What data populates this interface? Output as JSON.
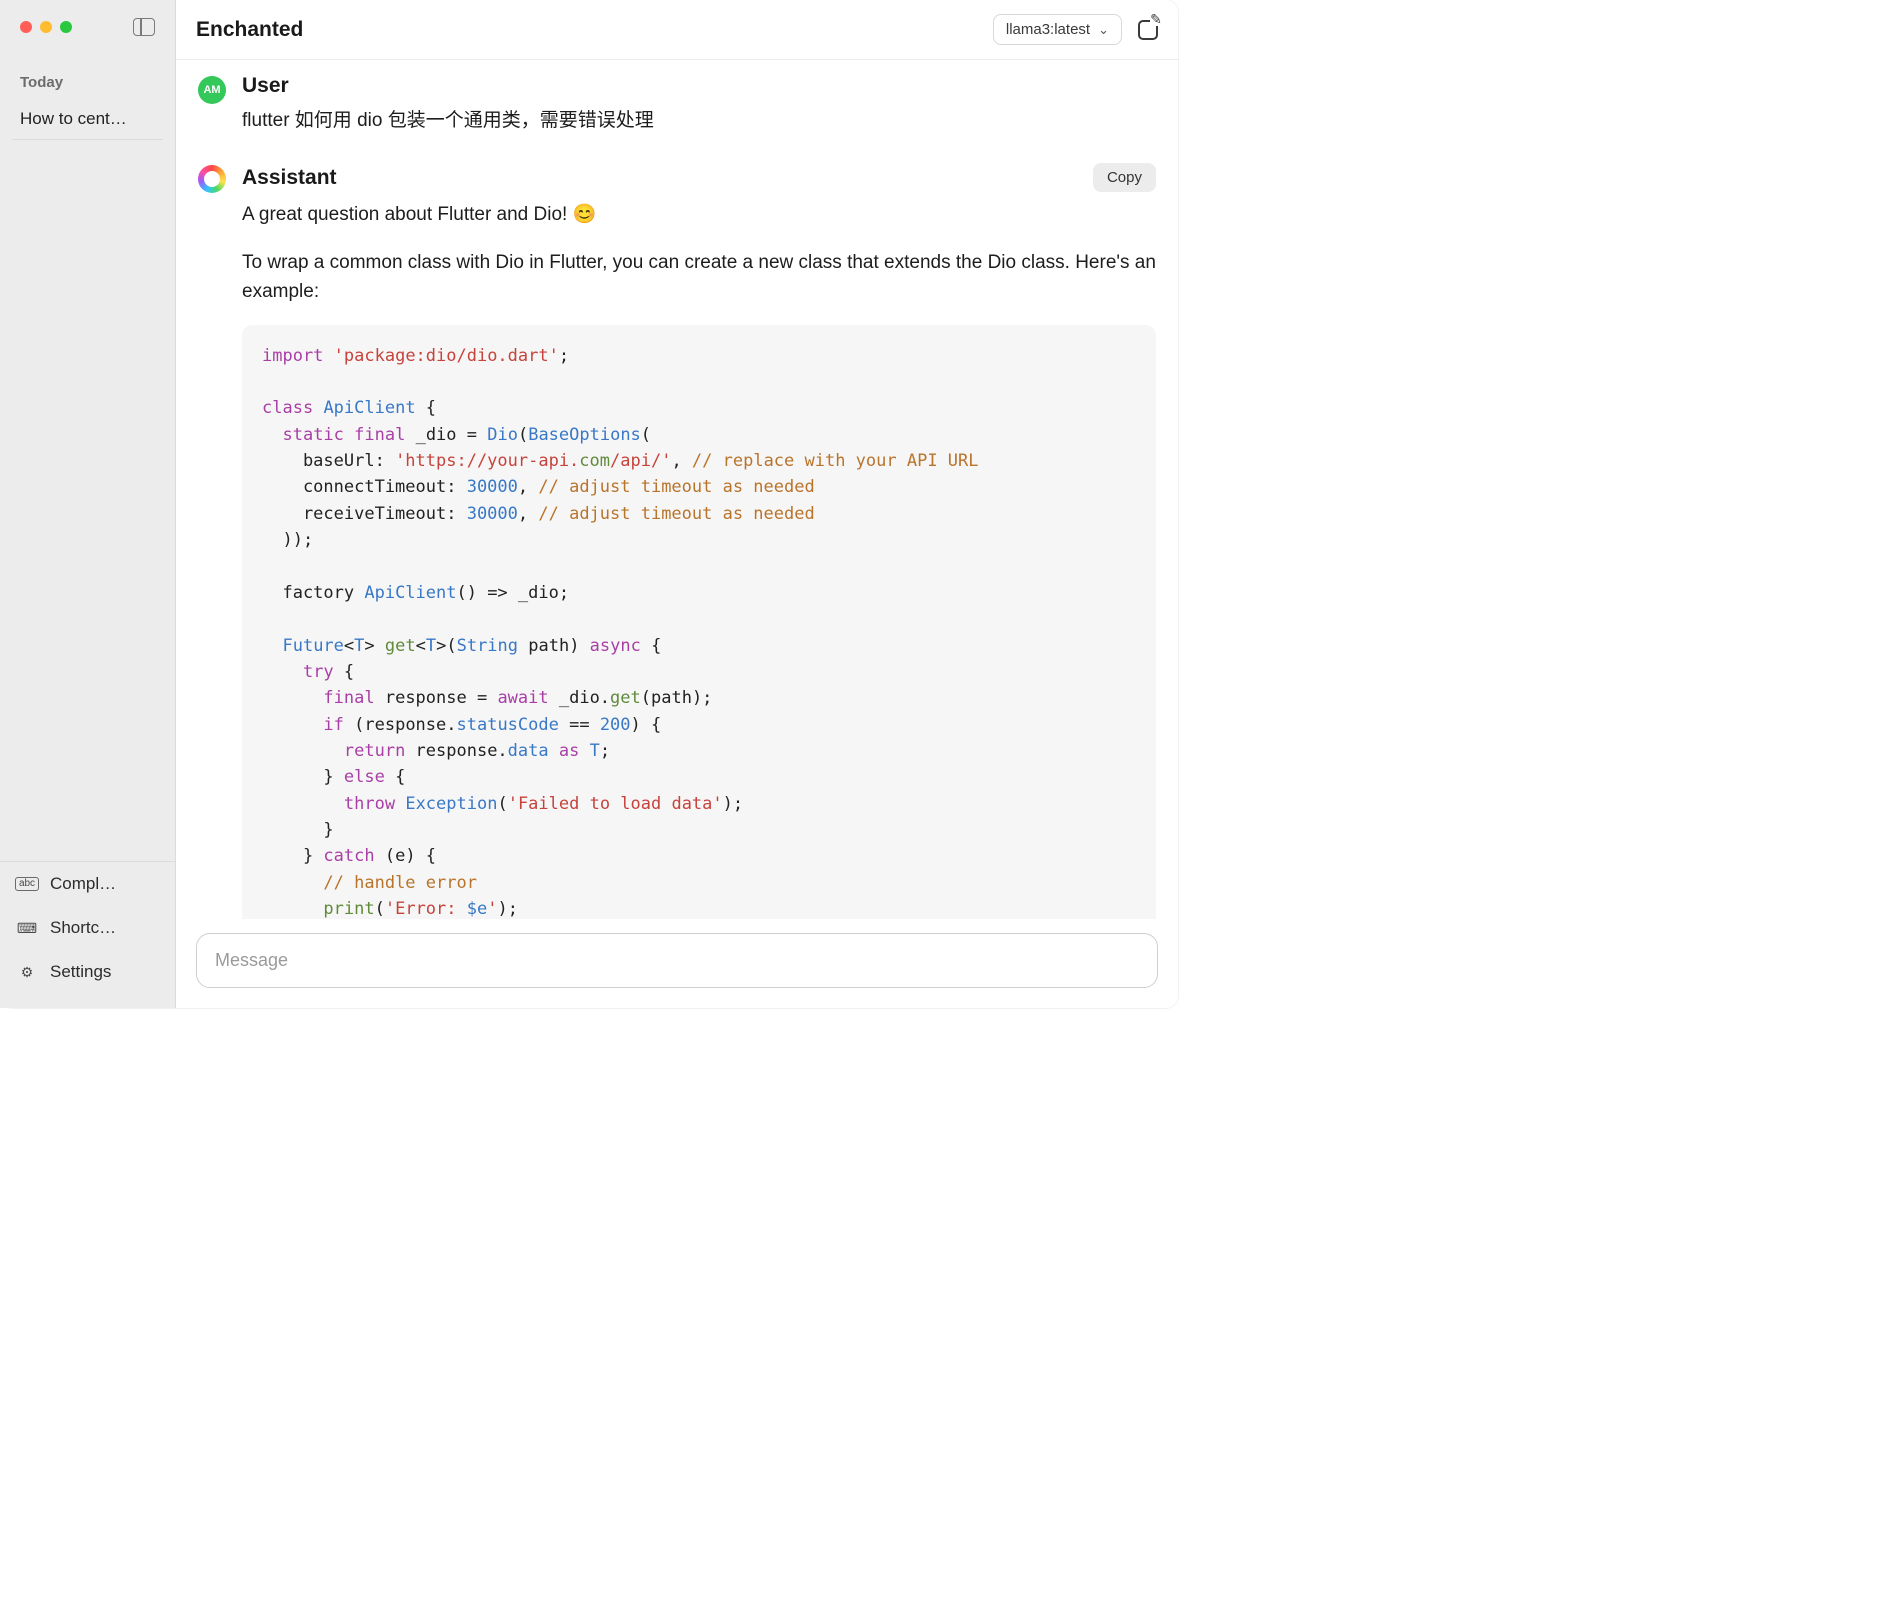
{
  "header": {
    "title": "Enchanted",
    "model": "llama3:latest"
  },
  "sidebar": {
    "section_label": "Today",
    "history": [
      "How to cent…"
    ],
    "footer": {
      "completions": "Compl…",
      "shortcuts": "Shortc…",
      "settings": "Settings"
    }
  },
  "chat": {
    "user": {
      "name": "User",
      "avatar_initials": "AM",
      "message": "flutter 如何用 dio 包装一个通用类，需要错误处理"
    },
    "assistant": {
      "name": "Assistant",
      "copy_label": "Copy",
      "paragraphs": [
        "A great question about Flutter and Dio! 😊",
        "To wrap a common class with Dio in Flutter, you can create a new class that extends the Dio class. Here's an example:"
      ],
      "code_tokens": [
        [
          [
            "kw",
            "import"
          ],
          [
            "pl",
            " "
          ],
          [
            "str",
            "'package:dio/dio.dart'"
          ],
          [
            "pl",
            ";"
          ]
        ],
        [],
        [
          [
            "kw",
            "class"
          ],
          [
            "pl",
            " "
          ],
          [
            "type",
            "ApiClient"
          ],
          [
            "pl",
            " {"
          ]
        ],
        [
          [
            "pl",
            "  "
          ],
          [
            "kw",
            "static"
          ],
          [
            "pl",
            " "
          ],
          [
            "kw",
            "final"
          ],
          [
            "pl",
            " _dio = "
          ],
          [
            "type",
            "Dio"
          ],
          [
            "pl",
            "("
          ],
          [
            "type",
            "BaseOptions"
          ],
          [
            "pl",
            "("
          ]
        ],
        [
          [
            "pl",
            "    baseUrl: "
          ],
          [
            "str",
            "'https://your-api."
          ],
          [
            "call",
            "com"
          ],
          [
            "str",
            "/api/'"
          ],
          [
            "pl",
            ", "
          ],
          [
            "cm",
            "// replace with your API URL"
          ]
        ],
        [
          [
            "pl",
            "    connectTimeout:"
          ],
          [
            "pl",
            " "
          ],
          [
            "num",
            "30000"
          ],
          [
            "pl",
            ", "
          ],
          [
            "cm",
            "// adjust timeout as needed"
          ]
        ],
        [
          [
            "pl",
            "    receiveTimeout:"
          ],
          [
            "pl",
            " "
          ],
          [
            "num",
            "30000"
          ],
          [
            "pl",
            ", "
          ],
          [
            "cm",
            "// adjust timeout as needed"
          ]
        ],
        [
          [
            "pl",
            "  ));"
          ]
        ],
        [],
        [
          [
            "pl",
            "  factory "
          ],
          [
            "type",
            "ApiClient"
          ],
          [
            "pl",
            "() => _dio;"
          ]
        ],
        [],
        [
          [
            "pl",
            "  "
          ],
          [
            "type",
            "Future"
          ],
          [
            "pl",
            "<"
          ],
          [
            "type",
            "T"
          ],
          [
            "pl",
            "> "
          ],
          [
            "call",
            "get"
          ],
          [
            "pl",
            "<"
          ],
          [
            "type",
            "T"
          ],
          [
            "pl",
            ">("
          ],
          [
            "type",
            "String"
          ],
          [
            "pl",
            " path) "
          ],
          [
            "kw",
            "async"
          ],
          [
            "pl",
            " {"
          ]
        ],
        [
          [
            "pl",
            "    "
          ],
          [
            "kw",
            "try"
          ],
          [
            "pl",
            " {"
          ]
        ],
        [
          [
            "pl",
            "      "
          ],
          [
            "kw",
            "final"
          ],
          [
            "pl",
            " response = "
          ],
          [
            "kw",
            "await"
          ],
          [
            "pl",
            " _dio."
          ],
          [
            "call",
            "get"
          ],
          [
            "pl",
            "(path);"
          ]
        ],
        [
          [
            "pl",
            "      "
          ],
          [
            "kw",
            "if"
          ],
          [
            "pl",
            " (response."
          ],
          [
            "prop",
            "statusCode"
          ],
          [
            "pl",
            " == "
          ],
          [
            "num",
            "200"
          ],
          [
            "pl",
            ") {"
          ]
        ],
        [
          [
            "pl",
            "        "
          ],
          [
            "kw",
            "return"
          ],
          [
            "pl",
            " response."
          ],
          [
            "prop",
            "data"
          ],
          [
            "pl",
            " "
          ],
          [
            "kw",
            "as"
          ],
          [
            "pl",
            " "
          ],
          [
            "type",
            "T"
          ],
          [
            "pl",
            ";"
          ]
        ],
        [
          [
            "pl",
            "      } "
          ],
          [
            "kw",
            "else"
          ],
          [
            "pl",
            " {"
          ]
        ],
        [
          [
            "pl",
            "        "
          ],
          [
            "kw",
            "throw"
          ],
          [
            "pl",
            " "
          ],
          [
            "type",
            "Exception"
          ],
          [
            "pl",
            "("
          ],
          [
            "str",
            "'Failed to load data'"
          ],
          [
            "pl",
            ");"
          ]
        ],
        [
          [
            "pl",
            "      }"
          ]
        ],
        [
          [
            "pl",
            "    } "
          ],
          [
            "kw",
            "catch"
          ],
          [
            "pl",
            " (e) {"
          ]
        ],
        [
          [
            "pl",
            "      "
          ],
          [
            "cm",
            "// handle error"
          ]
        ],
        [
          [
            "pl",
            "      "
          ],
          [
            "call",
            "print"
          ],
          [
            "pl",
            "("
          ],
          [
            "str",
            "'Error: "
          ],
          [
            "prop",
            "$e"
          ],
          [
            "str",
            "'"
          ],
          [
            "pl",
            ");"
          ]
        ]
      ]
    }
  },
  "composer": {
    "placeholder": "Message"
  }
}
